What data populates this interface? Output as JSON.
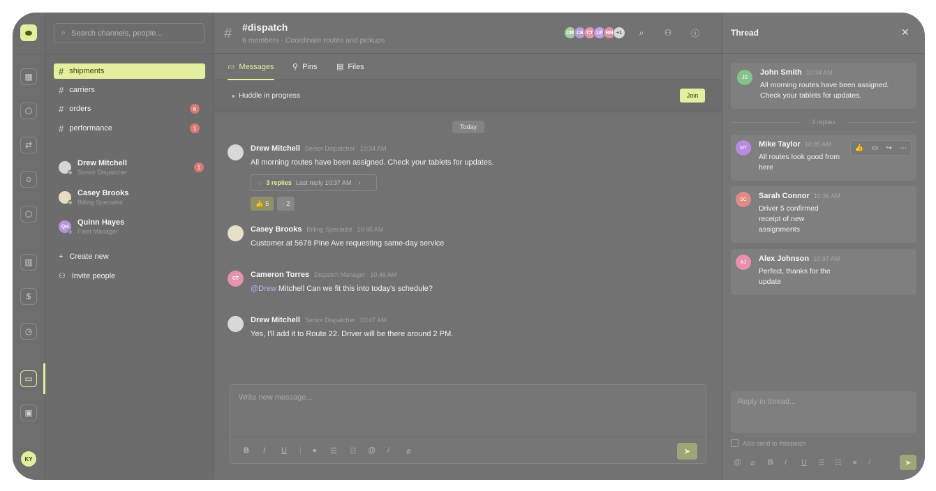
{
  "colors": {
    "accent": "#e3ee9e",
    "badge": "#d77a74",
    "online": "#8fbc8a"
  },
  "rail": {
    "items": [
      {
        "icon": "dashboard-icon",
        "glyph": "▦"
      },
      {
        "icon": "package-icon",
        "glyph": "⬡"
      },
      {
        "icon": "routes-icon",
        "glyph": "⇄"
      },
      {
        "icon": "contacts-icon",
        "glyph": "☺"
      },
      {
        "icon": "box-icon",
        "glyph": "⬡"
      },
      {
        "icon": "chart-icon",
        "glyph": "▥"
      },
      {
        "icon": "dollar-icon",
        "glyph": "$"
      },
      {
        "icon": "clock-icon",
        "glyph": "◷"
      },
      {
        "icon": "chat-icon",
        "glyph": "▭"
      },
      {
        "icon": "document-icon",
        "glyph": "▣"
      }
    ],
    "user_initials": "KY"
  },
  "sidebar": {
    "search_placeholder": "Search channels, people...",
    "channels": [
      {
        "name": "shipments",
        "active": true,
        "badge": ""
      },
      {
        "name": "carriers",
        "active": false,
        "badge": ""
      },
      {
        "name": "orders",
        "active": false,
        "badge": "6"
      },
      {
        "name": "performance",
        "active": false,
        "badge": "1"
      }
    ],
    "dms": [
      {
        "name": "Drew Mitchell",
        "role": "Senior Dispatcher",
        "badge": "1",
        "initials": ""
      },
      {
        "name": "Casey Brooks",
        "role": "Billing Specialist",
        "badge": "",
        "initials": ""
      },
      {
        "name": "Quinn Hayes",
        "role": "Fleet Manager",
        "badge": "",
        "initials": "QH"
      }
    ],
    "create_label": "Create new",
    "invite_label": "Invite people"
  },
  "channel": {
    "name": "#dispatch",
    "members": "6 members",
    "topic": "Coordinate routes and pickups",
    "member_avatars": [
      {
        "initials": "DM",
        "color": "#9fcf9c"
      },
      {
        "initials": "CB",
        "color": "#b39ad6"
      },
      {
        "initials": "CT",
        "color": "#e693ad"
      },
      {
        "initials": "LP",
        "color": "#c4a0e6"
      },
      {
        "initials": "RM",
        "color": "#e08fa8"
      },
      {
        "initials": "+1",
        "color": "#d9d9d9"
      }
    ],
    "tabs": [
      "Messages",
      "Pins",
      "Files"
    ],
    "huddle_text": "Huddle in progress",
    "join_label": "Join",
    "date_divider": "Today",
    "messages": [
      {
        "name": "Drew Mitchell",
        "role": "Senior Dispatcher",
        "time": "10:34 AM",
        "mention": "",
        "text": "All morning routes have been assigned. Check your tablets for updates.",
        "replies_count": "3 replies",
        "last_reply": "Last reply 10:37 AM",
        "react1": "5",
        "react2": "2"
      },
      {
        "name": "Casey Brooks",
        "role": "Billing Specialist",
        "time": "10:45 AM",
        "mention": "",
        "text": "Customer at 5678 Pine Ave requesting same-day service"
      },
      {
        "name": "Cameron Torres",
        "role": "Dispatch Manager",
        "time": "10:46 AM",
        "mention": "@Drew",
        "text": " Mitchell Can we fit this into today's schedule?",
        "initials": "CT"
      },
      {
        "name": "Drew Mitchell",
        "role": "Senior Dispatcher",
        "time": "10:47 AM",
        "mention": "",
        "text": "Yes, I'll add it to Route 22. Driver will be there around 2 PM."
      }
    ],
    "composer_placeholder": "Write new message..."
  },
  "thread": {
    "title": "Thread",
    "parent": {
      "name": "John Smith",
      "initials": "JS",
      "time": "10:34 AM",
      "text": "All morning routes have been assigned. Check your tablets for updates."
    },
    "reply_count": "3 replies",
    "replies": [
      {
        "name": "Mike Taylor",
        "initials": "MT",
        "time": "10:35 AM",
        "text": "All routes look good from here",
        "color": "#b98ae0"
      },
      {
        "name": "Sarah Connor",
        "initials": "SC",
        "time": "10:36 AM",
        "text": "Driver 5 confirmed receipt of new assignments",
        "color": "#e08c85"
      },
      {
        "name": "Alex Johnson",
        "initials": "AJ",
        "time": "10:37 AM",
        "text": "Perfect, thanks for the update",
        "color": "#e98fb0"
      }
    ],
    "reply_placeholder": "Reply in thread...",
    "also_send": "Also send to #dispatch"
  }
}
